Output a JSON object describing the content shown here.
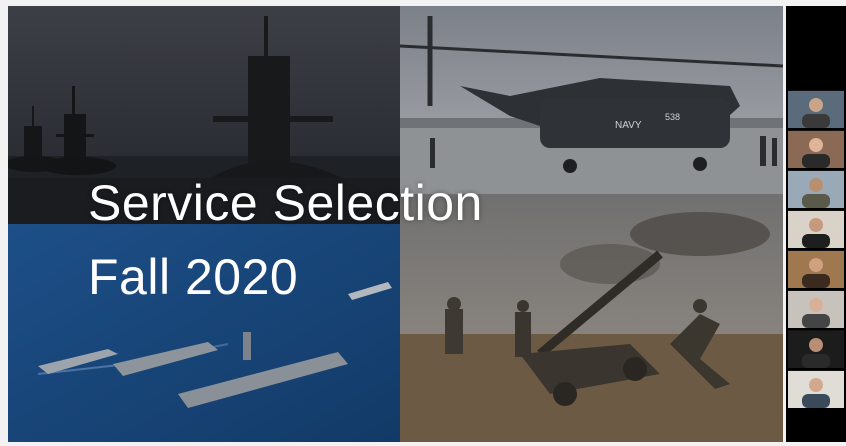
{
  "slide": {
    "title": "Service Selection",
    "subtitle": "Fall 2020",
    "background_panels": [
      "submarines-photo",
      "helicopter-photo",
      "naval-fleet-photo",
      "artillery-photo"
    ],
    "text_color": "#ffffff"
  },
  "participants": {
    "count": 8,
    "tiles": [
      {
        "name": "participant-1",
        "bg": "#5a6b7c",
        "skin": "#c9a48a",
        "shirt": "#3a3a3a"
      },
      {
        "name": "participant-2",
        "bg": "#8a6a55",
        "skin": "#e0b49a",
        "shirt": "#2a2a2a"
      },
      {
        "name": "participant-3",
        "bg": "#9aa9b8",
        "skin": "#b89070",
        "shirt": "#5a5a4a"
      },
      {
        "name": "participant-4",
        "bg": "#d8d2c8",
        "skin": "#c79a7e",
        "shirt": "#1e1e1e"
      },
      {
        "name": "participant-5",
        "bg": "#a07850",
        "skin": "#d0a080",
        "shirt": "#3a2a20"
      },
      {
        "name": "participant-6",
        "bg": "#c7c2bb",
        "skin": "#d8b09a",
        "shirt": "#444444"
      },
      {
        "name": "participant-7",
        "bg": "#1c1c1c",
        "skin": "#b88f76",
        "shirt": "#2a2a2a"
      },
      {
        "name": "participant-8",
        "bg": "#e0ddd6",
        "skin": "#d3a98e",
        "shirt": "#3a4a5a"
      }
    ]
  }
}
